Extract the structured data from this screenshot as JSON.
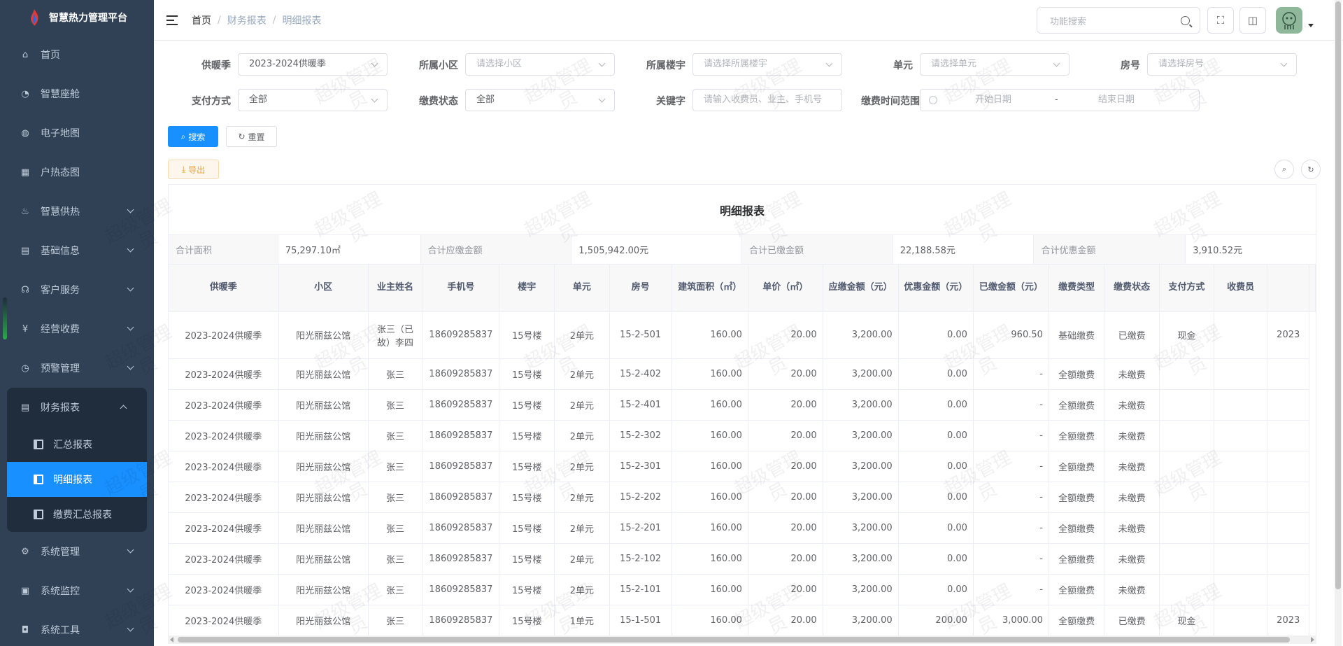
{
  "app": {
    "title": "智慧热力管理平台"
  },
  "sidebar": {
    "items": [
      {
        "label": "首页",
        "icon": "home-icon"
      },
      {
        "label": "智慧座舱",
        "icon": "dashboard-icon"
      },
      {
        "label": "电子地图",
        "icon": "globe-icon"
      },
      {
        "label": "户热态图",
        "icon": "grid-icon"
      },
      {
        "label": "智慧供热",
        "icon": "heat-icon"
      },
      {
        "label": "基础信息",
        "icon": "document-icon"
      },
      {
        "label": "客户服务",
        "icon": "service-icon"
      },
      {
        "label": "经营收费",
        "icon": "yen-icon"
      },
      {
        "label": "预警管理",
        "icon": "alarm-icon"
      },
      {
        "label": "财务报表",
        "icon": "report-icon"
      },
      {
        "label": "系统管理",
        "icon": "gear-icon"
      },
      {
        "label": "系统监控",
        "icon": "monitor-icon"
      },
      {
        "label": "系统工具",
        "icon": "toolbox-icon"
      }
    ],
    "sub_items": [
      {
        "label": "汇总报表"
      },
      {
        "label": "明细报表"
      },
      {
        "label": "缴费汇总报表"
      }
    ]
  },
  "header": {
    "breadcrumb": [
      "首页",
      "财务报表",
      "明细报表"
    ],
    "search_placeholder": "功能搜索"
  },
  "filters": {
    "season": {
      "label": "供暖季",
      "value": "2023-2024供暖季"
    },
    "community": {
      "label": "所属小区",
      "placeholder": "请选择小区"
    },
    "building": {
      "label": "所属楼宇",
      "placeholder": "请选择所属楼宇"
    },
    "unit": {
      "label": "单元",
      "placeholder": "请选择单元"
    },
    "room": {
      "label": "房号",
      "placeholder": "请选择房号"
    },
    "pay_method": {
      "label": "支付方式",
      "value": "全部"
    },
    "pay_status": {
      "label": "缴费状态",
      "value": "全部"
    },
    "keyword": {
      "label": "关键字",
      "placeholder": "请输入收费员、业主、手机号"
    },
    "date_range": {
      "label": "缴费时间范围",
      "start": "开始日期",
      "sep": "-",
      "end": "结束日期"
    }
  },
  "buttons": {
    "search": "搜索",
    "reset": "重置",
    "export": "导出"
  },
  "report": {
    "title": "明细报表",
    "summary": [
      {
        "label": "合计面积",
        "value": "75,297.10㎡"
      },
      {
        "label": "合计应缴金额",
        "value": "1,505,942.00元"
      },
      {
        "label": "合计已缴金额",
        "value": "22,188.58元"
      },
      {
        "label": "合计优惠金额",
        "value": "3,910.52元"
      }
    ],
    "columns": [
      "供暖季",
      "小区",
      "业主姓名",
      "手机号",
      "楼宇",
      "单元",
      "房号",
      "建筑面积（㎡）",
      "单价（㎡）",
      "应缴金额（元）",
      "优惠金额（元）",
      "已缴金额（元）",
      "缴费类型",
      "缴费状态",
      "支付方式",
      "收费员",
      ""
    ],
    "rows": [
      [
        "2023-2024供暖季",
        "阳光丽兹公馆",
        "张三（已故）李四",
        "18609285837",
        "15号楼",
        "2单元",
        "15-2-501",
        "160.00",
        "20.00",
        "3,200.00",
        "0.00",
        "960.50",
        "基础缴费",
        "已缴费",
        "现金",
        "",
        "2023"
      ],
      [
        "2023-2024供暖季",
        "阳光丽兹公馆",
        "张三",
        "18609285837",
        "15号楼",
        "2单元",
        "15-2-402",
        "160.00",
        "20.00",
        "3,200.00",
        "0.00",
        "-",
        "全额缴费",
        "未缴费",
        "",
        "",
        ""
      ],
      [
        "2023-2024供暖季",
        "阳光丽兹公馆",
        "张三",
        "18609285837",
        "15号楼",
        "2单元",
        "15-2-401",
        "160.00",
        "20.00",
        "3,200.00",
        "0.00",
        "-",
        "全额缴费",
        "未缴费",
        "",
        "",
        ""
      ],
      [
        "2023-2024供暖季",
        "阳光丽兹公馆",
        "张三",
        "18609285837",
        "15号楼",
        "2单元",
        "15-2-302",
        "160.00",
        "20.00",
        "3,200.00",
        "0.00",
        "-",
        "全额缴费",
        "未缴费",
        "",
        "",
        ""
      ],
      [
        "2023-2024供暖季",
        "阳光丽兹公馆",
        "张三",
        "18609285837",
        "15号楼",
        "2单元",
        "15-2-301",
        "160.00",
        "20.00",
        "3,200.00",
        "0.00",
        "-",
        "全额缴费",
        "未缴费",
        "",
        "",
        ""
      ],
      [
        "2023-2024供暖季",
        "阳光丽兹公馆",
        "张三",
        "18609285837",
        "15号楼",
        "2单元",
        "15-2-202",
        "160.00",
        "20.00",
        "3,200.00",
        "0.00",
        "-",
        "全额缴费",
        "未缴费",
        "",
        "",
        ""
      ],
      [
        "2023-2024供暖季",
        "阳光丽兹公馆",
        "张三",
        "18609285837",
        "15号楼",
        "2单元",
        "15-2-201",
        "160.00",
        "20.00",
        "3,200.00",
        "0.00",
        "-",
        "全额缴费",
        "未缴费",
        "",
        "",
        ""
      ],
      [
        "2023-2024供暖季",
        "阳光丽兹公馆",
        "张三",
        "18609285837",
        "15号楼",
        "2单元",
        "15-2-102",
        "160.00",
        "20.00",
        "3,200.00",
        "0.00",
        "-",
        "全额缴费",
        "未缴费",
        "",
        "",
        ""
      ],
      [
        "2023-2024供暖季",
        "阳光丽兹公馆",
        "张三",
        "18609285837",
        "15号楼",
        "2单元",
        "15-2-101",
        "160.00",
        "20.00",
        "3,200.00",
        "0.00",
        "-",
        "全额缴费",
        "未缴费",
        "",
        "",
        ""
      ],
      [
        "2023-2024供暖季",
        "阳光丽兹公馆",
        "张三",
        "18609285837",
        "15号楼",
        "1单元",
        "15-1-501",
        "160.00",
        "20.00",
        "3,200.00",
        "200.00",
        "3,000.00",
        "全额缴费",
        "已缴费",
        "现金",
        "",
        "2023"
      ]
    ]
  },
  "watermark": {
    "text1": "超级管理",
    "text2": "员"
  },
  "colors": {
    "sidebar_bg": "#304156",
    "active": "#1890ff",
    "sub_bg": "#1f2d3d"
  }
}
